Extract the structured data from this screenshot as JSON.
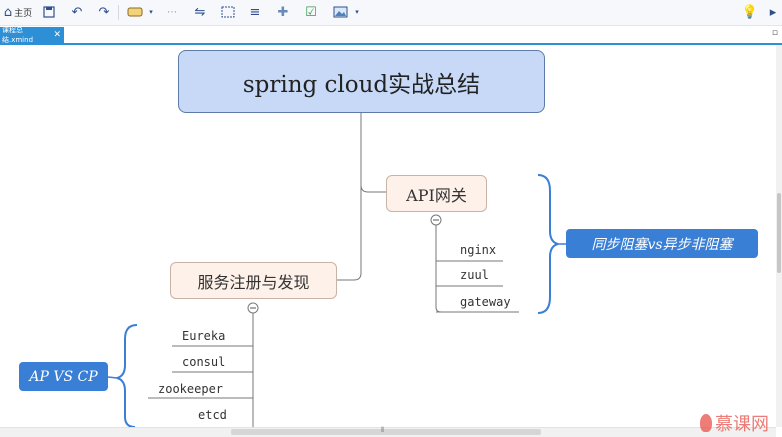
{
  "toolbar": {
    "home_label": "主页",
    "items": [
      "home-icon",
      "save-icon",
      "undo-icon",
      "redo-icon",
      "topic-icon",
      "dropdown-icon",
      "comment-icon",
      "relationship-icon",
      "boundary-icon",
      "summary-icon",
      "marker-icon",
      "task-icon",
      "image-icon",
      "dropdown-icon",
      "lightbulb-icon",
      "present-icon"
    ]
  },
  "tab": {
    "title": "课程总结.xmind",
    "close": "✕"
  },
  "map": {
    "central": "spring cloud实战总结",
    "api_gateway": {
      "label": "API网关",
      "children": [
        "nginx",
        "zuul",
        "gateway"
      ],
      "callout": "同步阻塞vs异步非阻塞"
    },
    "service_discovery": {
      "label": "服务注册与发现",
      "children": [
        "Eureka",
        "consul",
        "zookeeper",
        "etcd"
      ],
      "callout": "AP VS CP"
    },
    "collapse_symbol": "−"
  },
  "watermark": "慕课网",
  "colors": {
    "accent": "#2d8fd5",
    "central_fill": "#c7d9f7",
    "topic_fill": "#fdf1ea",
    "callout": "#3a7fd6"
  }
}
